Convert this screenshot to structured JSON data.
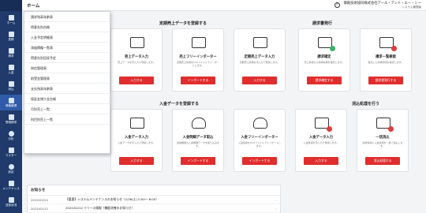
{
  "topbar": {
    "title": "ホーム",
    "company": "御殿技術協同株式会社アール・アンド・エー・シー",
    "department": "システム管理者"
  },
  "sidebar": {
    "items": [
      {
        "label": "ホーム",
        "icon": "home-icon"
      },
      {
        "label": "見積",
        "icon": "estimate-icon"
      },
      {
        "label": "請求",
        "icon": "invoice-icon"
      },
      {
        "label": "入金",
        "icon": "payment-icon"
      },
      {
        "label": "消込",
        "icon": "reconcile-icon"
      },
      {
        "label": "債権管理",
        "icon": "receivables-icon"
      },
      {
        "label": "受領請求",
        "icon": "received-invoice-icon"
      },
      {
        "label": "分析",
        "icon": "analytics-icon"
      },
      {
        "label": "マスター",
        "icon": "master-icon"
      },
      {
        "label": "設定",
        "icon": "settings-icon"
      },
      {
        "label": "メンテナンス",
        "icon": "maintenance-icon"
      },
      {
        "label": "送信状況",
        "icon": "send-status-icon"
      }
    ],
    "active_index": 5
  },
  "dropdown": {
    "items": [
      "請求残高年齢表",
      "得意先別台帳",
      "入金予定明細表",
      "滞留債権一覧表",
      "得意先別回収予定",
      "與信管理表",
      "前受金管理表",
      "支払残高年齢表",
      "保証金預り金台帳",
      "月別売上一覧",
      "科目別売上一覧"
    ]
  },
  "sections": {
    "sales": "定期売上データを登録する",
    "billing": "請求書発行",
    "deposit": "入金データを登録する",
    "reconcile": "消込処理を行う"
  },
  "cards": {
    "sales_manual": {
      "title": "売上データ入力",
      "desc": "売上データを手入力で登録します。",
      "button": "入力する"
    },
    "sales_free": {
      "title": "売上フリーインポーター",
      "desc": "定期売上情報をCSVファイルでインポートします。",
      "button": "インポートする"
    },
    "sales_input": {
      "title": "定期売上データ入力",
      "desc": "定期売上情報を手入力で登録します。",
      "button": "入力する"
    },
    "billing_confirm": {
      "title": "請求確定",
      "desc": "売上情報から請求情報を確定します。",
      "button": "請求確定する"
    },
    "billing_list": {
      "title": "請求一覧検索",
      "desc": "確定した請求情報を検索します。",
      "button": "請求書発行する"
    },
    "deposit_manual": {
      "title": "入金データ入力",
      "desc": "入金データを手入力で登録します。",
      "button": "入力する"
    },
    "deposit_import": {
      "title": "入金明細データ取込",
      "desc": "金融機関の入金明細データを取り込みます。",
      "button": "インポートする"
    },
    "deposit_free": {
      "title": "入金フリーインポーター",
      "desc": "入金情報をCSVファイルでインポートします。",
      "button": "インポートする"
    },
    "deposit_input": {
      "title": "入金データ入力",
      "desc": "入金情報を手入力で登録します。",
      "button": "入力する"
    },
    "reconcile_bulk": {
      "title": "一括消込",
      "desc": "請求情報と入金情報を一括で消込します。",
      "button": "消込処理する"
    }
  },
  "news": {
    "title": "お知らせ",
    "rows": [
      {
        "date": "2022/02/24",
        "text": "【重要】システムメンテナンスのお知らせ（2/26(土) 0:00〜 6:00）"
      },
      {
        "date": "2022/02/12",
        "text": "2022/02/12 リリース情報（機能改善のお知らせ）"
      }
    ]
  },
  "colors": {
    "sidebar": "#1f3a6b",
    "accent": "#e02d2d"
  }
}
